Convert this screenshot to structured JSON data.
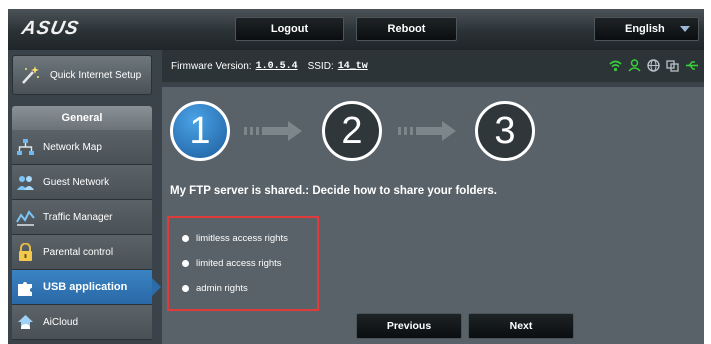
{
  "header": {
    "logo": "ASUS",
    "logout_label": "Logout",
    "reboot_label": "Reboot",
    "language": "English"
  },
  "sidebar": {
    "quick_setup_label": "Quick Internet Setup",
    "section_label": "General",
    "items": [
      {
        "label": "Network Map",
        "icon": "network-map-icon"
      },
      {
        "label": "Guest Network",
        "icon": "guest-network-icon"
      },
      {
        "label": "Traffic Manager",
        "icon": "traffic-manager-icon"
      },
      {
        "label": "Parental control",
        "icon": "lock-icon"
      },
      {
        "label": "USB application",
        "icon": "puzzle-icon",
        "active": true
      },
      {
        "label": "AiCloud",
        "icon": "cloud-icon"
      }
    ]
  },
  "status_bar": {
    "firmware_label": "Firmware Version:",
    "firmware_value": "1.0.5.4",
    "ssid_label": "SSID:",
    "ssid_value": "14_tw",
    "icons": [
      "wifi-icon",
      "user-icon",
      "globe-icon",
      "device-icon",
      "usb-icon"
    ]
  },
  "wizard": {
    "steps": [
      "1",
      "2",
      "3"
    ],
    "current_step": 1,
    "heading": "My FTP server is shared.: Decide how to share your folders.",
    "options": [
      {
        "label": "limitless access rights",
        "selected": true
      },
      {
        "label": "limited access rights",
        "selected": false
      },
      {
        "label": "admin rights",
        "selected": false
      }
    ],
    "previous_label": "Previous",
    "next_label": "Next"
  },
  "colors": {
    "accent_blue": "#2a68a6",
    "highlight_red": "#e03a3a",
    "status_green": "#35d13a"
  }
}
